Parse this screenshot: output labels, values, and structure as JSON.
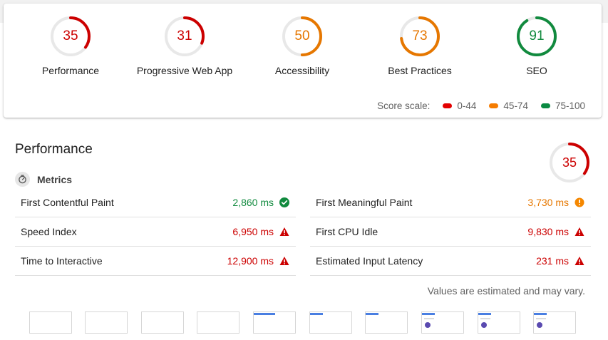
{
  "summary": {
    "gauges": [
      {
        "label": "Performance",
        "score": "35",
        "fraction": 0.35,
        "color": "#cc0000"
      },
      {
        "label": "Progressive Web App",
        "score": "31",
        "fraction": 0.31,
        "color": "#cc0000"
      },
      {
        "label": "Accessibility",
        "score": "50",
        "fraction": 0.5,
        "color": "#e67700"
      },
      {
        "label": "Best Practices",
        "score": "73",
        "fraction": 0.73,
        "color": "#e67700"
      },
      {
        "label": "SEO",
        "score": "91",
        "fraction": 0.91,
        "color": "#118a3e"
      }
    ],
    "scale": {
      "label": "Score scale:",
      "ranges": [
        {
          "text": "0-44",
          "color": "#e30000"
        },
        {
          "text": "45-74",
          "color": "#f57c00"
        },
        {
          "text": "75-100",
          "color": "#0b8a42"
        }
      ]
    }
  },
  "performance": {
    "title": "Performance",
    "score": "35",
    "fraction": 0.35,
    "color": "#cc0000",
    "metrics_label": "Metrics",
    "metrics": [
      {
        "name": "First Contentful Paint",
        "value": "2,860 ms",
        "status": "pass",
        "color": "#118a3e",
        "icon": "check-circle-icon"
      },
      {
        "name": "First Meaningful Paint",
        "value": "3,730 ms",
        "status": "average",
        "color": "#e67700",
        "icon": "info-circle-icon"
      },
      {
        "name": "Speed Index",
        "value": "6,950 ms",
        "status": "fail",
        "color": "#cc0000",
        "icon": "warning-triangle-icon"
      },
      {
        "name": "First CPU Idle",
        "value": "9,830 ms",
        "status": "fail",
        "color": "#cc0000",
        "icon": "warning-triangle-icon"
      },
      {
        "name": "Time to Interactive",
        "value": "12,900 ms",
        "status": "fail",
        "color": "#cc0000",
        "icon": "warning-triangle-icon"
      },
      {
        "name": "Estimated Input Latency",
        "value": "231 ms",
        "status": "fail",
        "color": "#cc0000",
        "icon": "warning-triangle-icon"
      }
    ],
    "note": "Values are estimated and may vary."
  }
}
